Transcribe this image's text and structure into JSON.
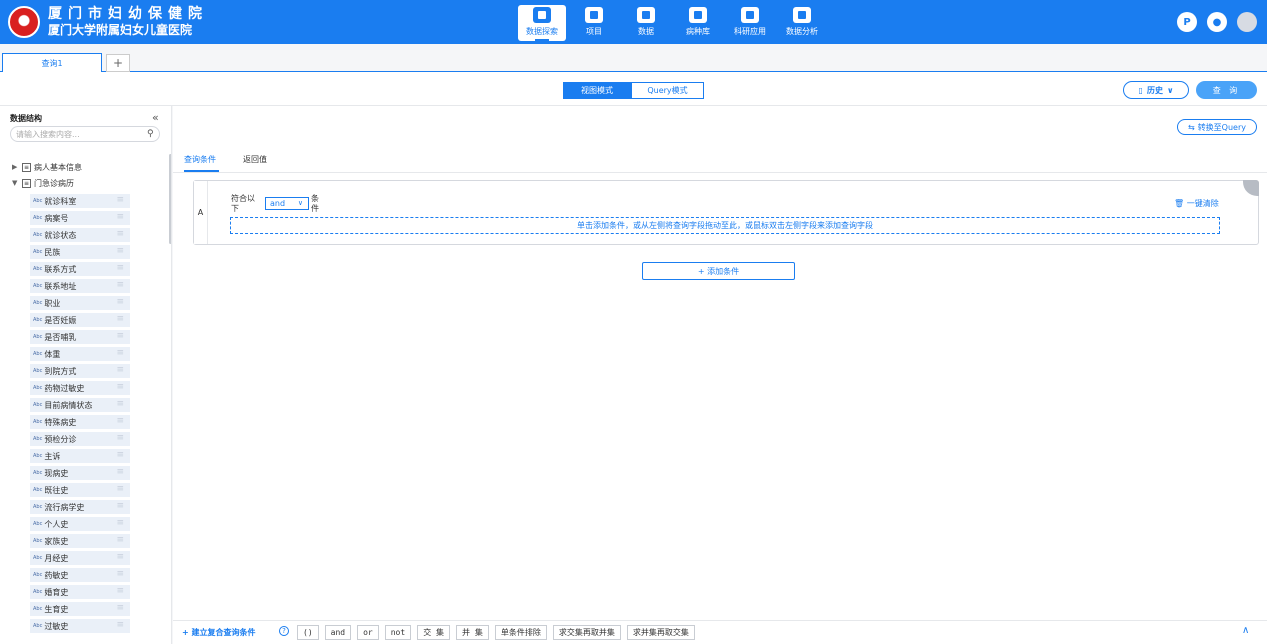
{
  "header": {
    "title_line1": "厦门市妇幼保健院",
    "title_line2": "厦门大学附属妇女儿童医院",
    "nav": [
      {
        "label": "数据探索",
        "icon": "database-icon",
        "active": true
      },
      {
        "label": "项目",
        "icon": "layers-icon",
        "active": false
      },
      {
        "label": "数据",
        "icon": "document-icon",
        "active": false
      },
      {
        "label": "病种库",
        "icon": "inbox-icon",
        "active": false
      },
      {
        "label": "科研应用",
        "icon": "apps-icon",
        "active": false
      },
      {
        "label": "数据分析",
        "icon": "analytics-icon",
        "active": false
      }
    ],
    "user_initial": "P"
  },
  "tabs": {
    "items": [
      "查询1"
    ],
    "add_label": "+"
  },
  "modebar": {
    "mode_view": "视图模式",
    "mode_query": "Query模式",
    "history_label": "历史",
    "query_label": "查 询"
  },
  "sidebar": {
    "title": "数据结构",
    "collapse": "«",
    "search_placeholder": "请输入搜索内容...",
    "tree": [
      {
        "label": "病人基本信息",
        "expanded": false
      },
      {
        "label": "门急诊病历",
        "expanded": true
      }
    ],
    "fields": [
      "就诊科室",
      "病案号",
      "就诊状态",
      "民族",
      "联系方式",
      "联系地址",
      "职业",
      "是否妊娠",
      "是否哺乳",
      "体重",
      "到院方式",
      "药物过敏史",
      "目前病情状态",
      "特殊病史",
      "预检分诊",
      "主诉",
      "现病史",
      "既往史",
      "流行病学史",
      "个人史",
      "家族史",
      "月经史",
      "药敏史",
      "婚育史",
      "生育史",
      "过敏史"
    ],
    "field_badge": "Abc"
  },
  "main": {
    "convert_label": "转换至Query",
    "subtabs": [
      "查询条件",
      "返回值"
    ],
    "condition": {
      "group_letter": "A",
      "prefix": "符合以下",
      "operator": "and",
      "suffix": "条件",
      "clear_label": "一键清除",
      "drop_hint": "单击添加条件，或从左侧将查询字段拖动至此，或鼠标双击左侧字段来添加查询字段"
    },
    "add_condition_label": "+ 添加条件"
  },
  "bottombar": {
    "new_compound_label": "+ 建立复合查询条件",
    "buttons": [
      "()",
      "and",
      "or",
      "not",
      "交 集",
      "并 集",
      "单条件排除",
      "求交集再取并集",
      "求并集再取交集"
    ]
  },
  "colors": {
    "primary": "#1a7df0",
    "header_bg": "#1a7df0",
    "field_bg": "#eaf0f8",
    "logo_red": "#d92020"
  }
}
